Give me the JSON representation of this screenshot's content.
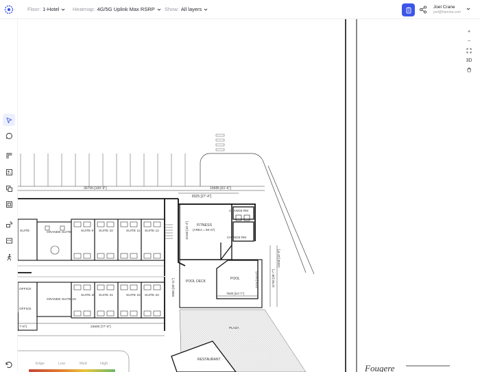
{
  "header": {
    "floor_label": "Floor:",
    "floor_value": "1-Hotel",
    "heatmap_label": "Heatmap:",
    "heatmap_value": "4G/5G Uplink Max RSRP",
    "show_label": "Show:",
    "show_value": "All layers"
  },
  "user": {
    "name": "Joel Crane",
    "email": "joel@hamina.com"
  },
  "zoom_controls": {
    "zoom_in": "+",
    "zoom_out": "−",
    "mode_3d": "3D"
  },
  "legend": {
    "labels": [
      "Edge",
      "Low",
      "Med",
      "High"
    ]
  },
  "plan": {
    "dimensions": [
      "30700 [100'-9\"]",
      "15685 [51'-6\"]",
      "8325 [27'-4\"]",
      "10160 [33'-4\"]",
      "23600 [77'-5\"]",
      "7'-8\"]",
      "7500 [24'-7\"]",
      "20300 [66'-7\"]",
      "8800 [28'-11\"]",
      "7315 [24'-0\"]",
      "11760 [38'-7\"]",
      "13340 [43'-9\"]"
    ],
    "rooms": {
      "fitness": "FITNESS",
      "fitness_area": "(AREA = 80 m²)",
      "change_rm_top": "CHANGE RM",
      "change_rm_bottom": "CHANGE RM",
      "pool": "POOL",
      "pool_deck": "POOL DECK",
      "plaza": "PLAZA",
      "restaurant": "RESTAURANT",
      "office_1": "OFFICE",
      "office_2": "OFFICE",
      "suite": "SUITE",
      "suite_9": "SUITE 9",
      "suite_10": "SUITE 10",
      "suite_11": "SUITE 11",
      "suite_12": "SUITE 12",
      "suite_20": "SUITE 20",
      "suite_21": "SUITE 21",
      "suite_22": "SUITE 22",
      "suite_23": "SUITE 23",
      "grande_1": "GRANDE SUITE",
      "grande_19": "GRANDE SUITE 19"
    },
    "brand": "Fougere"
  }
}
